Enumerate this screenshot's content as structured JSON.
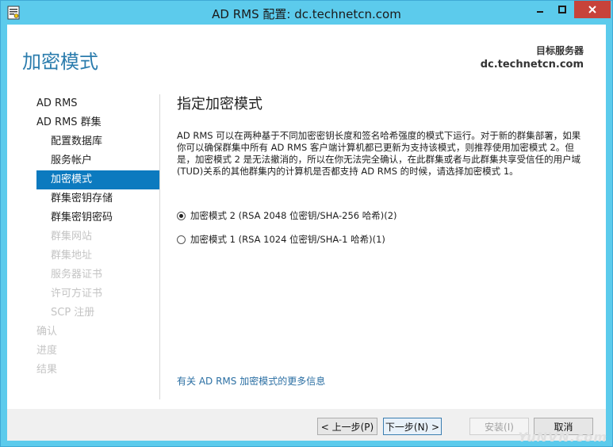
{
  "window": {
    "title": "AD RMS 配置: dc.technetcn.com",
    "controls": [
      "minimize-icon",
      "maximize-icon",
      "close-icon"
    ]
  },
  "header": {
    "title": "加密模式",
    "target_label": "目标服务器",
    "target_value": "dc.technetcn.com"
  },
  "nav": {
    "items": [
      {
        "label": "AD RMS",
        "state": "normal",
        "level": 0
      },
      {
        "label": "AD RMS 群集",
        "state": "normal",
        "level": 0
      },
      {
        "label": "配置数据库",
        "state": "normal",
        "level": 1
      },
      {
        "label": "服务帐户",
        "state": "normal",
        "level": 1
      },
      {
        "label": "加密模式",
        "state": "active",
        "level": 1
      },
      {
        "label": "群集密钥存储",
        "state": "normal",
        "level": 1
      },
      {
        "label": "群集密钥密码",
        "state": "normal",
        "level": 1
      },
      {
        "label": "群集网站",
        "state": "disabled",
        "level": 1
      },
      {
        "label": "群集地址",
        "state": "disabled",
        "level": 1
      },
      {
        "label": "服务器证书",
        "state": "disabled",
        "level": 1
      },
      {
        "label": "许可方证书",
        "state": "disabled",
        "level": 1
      },
      {
        "label": "SCP 注册",
        "state": "disabled",
        "level": 1
      },
      {
        "label": "确认",
        "state": "disabled",
        "level": 0
      },
      {
        "label": "进度",
        "state": "disabled",
        "level": 0
      },
      {
        "label": "结果",
        "state": "disabled",
        "level": 0
      }
    ]
  },
  "main": {
    "heading": "指定加密模式",
    "description": "AD RMS 可以在两种基于不同加密密钥长度和签名哈希强度的模式下运行。对于新的群集部署，如果你可以确保群集中所有 AD RMS 客户端计算机都已更新为支持该模式，则推荐使用加密模式 2。但是，加密模式 2 是无法撤消的，所以在你无法完全确认，在此群集或者与此群集共享受信任的用户域(TUD)关系的其他群集内的计算机是否都支持 AD RMS 的时候，请选择加密模式 1。",
    "options": [
      {
        "label": "加密模式 2 (RSA 2048 位密钥/SHA-256 哈希)(2)",
        "checked": true
      },
      {
        "label": "加密模式 1 (RSA 1024 位密钥/SHA-1 哈希)(1)",
        "checked": false
      }
    ],
    "more_info_link": "有关 AD RMS 加密模式的更多信息"
  },
  "footer": {
    "prev_label": "< 上一步(P)",
    "next_label": "下一步(N) >",
    "install_label": "安装(I)",
    "cancel_label": "取消"
  },
  "watermark": "YuNVN.com",
  "colors": {
    "titlebar": "#5ccbec",
    "accent_title": "#2b7cad",
    "nav_active": "#0c7abf",
    "close_button": "#c7433a",
    "link": "#2b6fa3"
  }
}
